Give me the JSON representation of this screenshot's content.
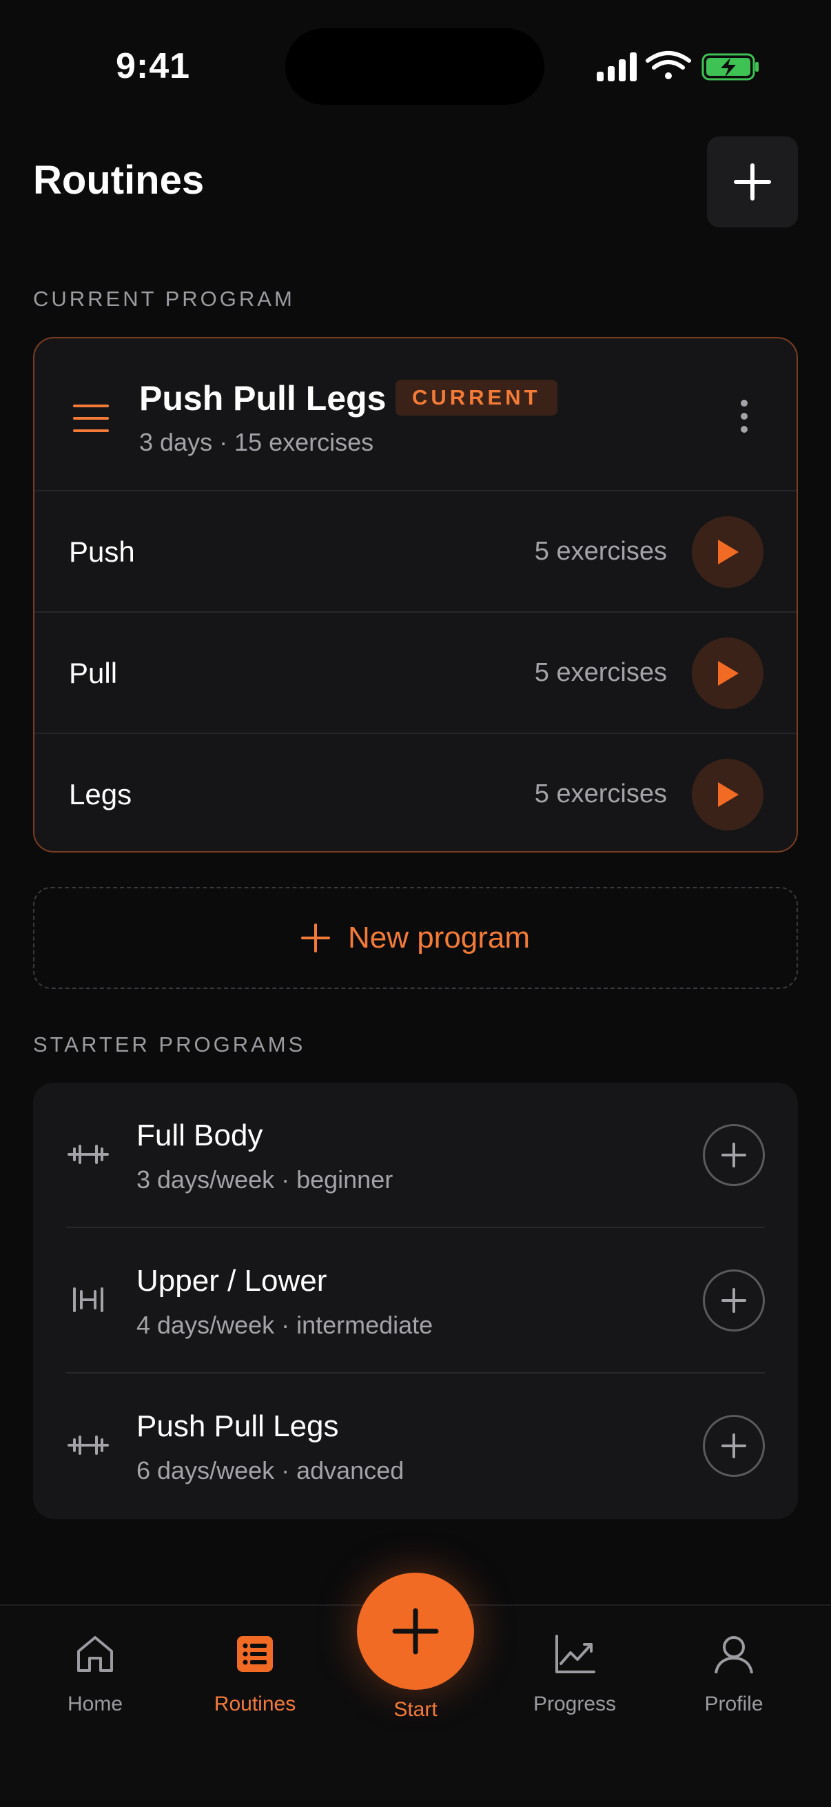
{
  "status_bar": {
    "time": "9:41"
  },
  "header": {
    "title": "Routines"
  },
  "current_program": {
    "section_label": "CURRENT PROGRAM",
    "name": "Push Pull Legs",
    "badge": "CURRENT",
    "meta": "3 days · 15 exercises",
    "days": [
      {
        "name": "Push",
        "count": "5 exercises"
      },
      {
        "name": "Pull",
        "count": "5 exercises"
      },
      {
        "name": "Legs",
        "count": "5 exercises"
      }
    ]
  },
  "new_program": {
    "label": "New program"
  },
  "starter": {
    "section_label": "STARTER PROGRAMS",
    "programs": [
      {
        "name": "Full Body",
        "meta": "3 days/week · beginner",
        "icon": "dumbbell-icon"
      },
      {
        "name": "Upper / Lower",
        "meta": "4 days/week · intermediate",
        "icon": "barbell-rack-icon"
      },
      {
        "name": "Push Pull Legs",
        "meta": "6 days/week · advanced",
        "icon": "dumbbell-icon"
      }
    ]
  },
  "tabs": [
    {
      "label": "Home",
      "icon": "home-icon",
      "active": false
    },
    {
      "label": "Routines",
      "icon": "list-icon",
      "active": true
    },
    {
      "label": "Start",
      "icon": "plus-icon",
      "active": false
    },
    {
      "label": "Progress",
      "icon": "chart-icon",
      "active": false
    },
    {
      "label": "Profile",
      "icon": "user-icon",
      "active": false
    }
  ],
  "colors": {
    "accent": "#f26b25",
    "background": "#0b0b0c",
    "card": "#151517",
    "battery": "#3fc254"
  }
}
